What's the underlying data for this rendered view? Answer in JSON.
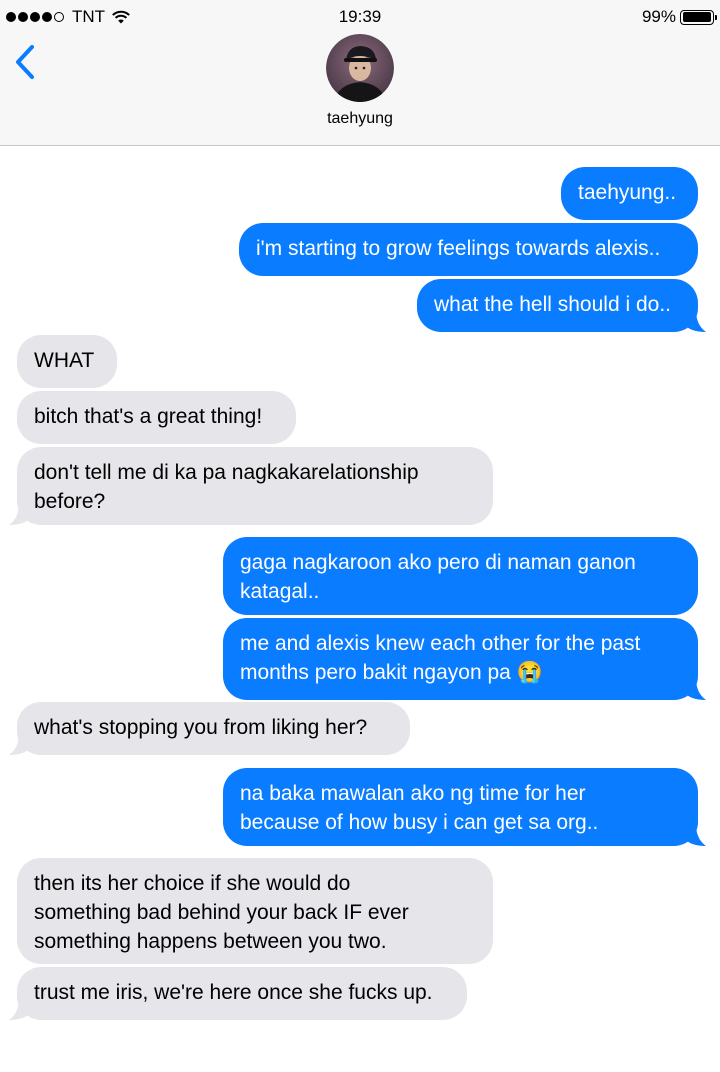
{
  "status_bar": {
    "carrier": "TNT",
    "time": "19:39",
    "battery": "99%",
    "battery_level": 0.99
  },
  "nav": {
    "contact_name": "taehyung"
  },
  "messages": [
    {
      "type": "sent",
      "text": "taehyung.."
    },
    {
      "type": "sent",
      "text": "i'm starting to grow feelings towards alexis.."
    },
    {
      "type": "sent",
      "text": "what the hell should i do.."
    },
    {
      "type": "received",
      "text": "WHAT"
    },
    {
      "type": "received",
      "text": "bitch that's a great thing!"
    },
    {
      "type": "received",
      "lines": [
        "don't tell me di ka pa nagkakarelationship",
        "before?"
      ]
    },
    {
      "type": "sent",
      "lines": [
        "gaga nagkaroon ako pero di naman ganon",
        "katagal.."
      ]
    },
    {
      "type": "sent",
      "lines": [
        "me and alexis knew each other for the past",
        "months pero bakit ngayon pa 😭"
      ]
    },
    {
      "type": "received",
      "text": "what's stopping you from liking her?"
    },
    {
      "type": "sent",
      "lines": [
        "na baka mawalan ako ng time for her",
        "because of how busy i can get sa org.."
      ]
    },
    {
      "type": "received",
      "lines": [
        "then its her choice if she would do",
        "something bad behind your back IF ever",
        "something happens between you two."
      ]
    },
    {
      "type": "received",
      "text": "trust me iris, we're here once she fucks up."
    }
  ]
}
